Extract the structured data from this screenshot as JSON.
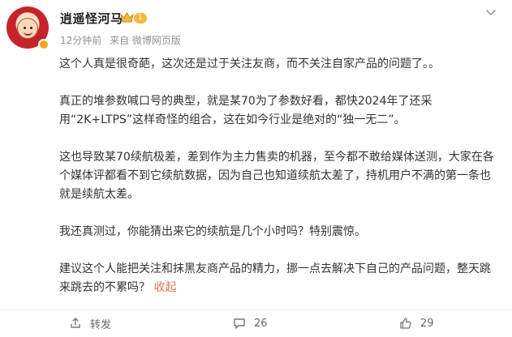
{
  "post": {
    "username": "逍遥怪河马",
    "level_badge": "1",
    "time": "12分钟前",
    "source": "来自 微博网页版",
    "paragraphs": [
      "这个人真是很奇葩，这次还是过于关注友商，而不关注自家产品的问题了。。",
      "真正的堆参数喊口号的典型，就是某70为了参数好看，都快2024年了还采用“2K+LTPS”这样奇怪的组合，这在如今行业是绝对的“独一无二”。",
      "这也导致某70续航极差，差到作为主力售卖的机器，至今都不敢给媒体送测，大家在各个媒体评都看不到它续航数据，因为自己也知道续航太差了，持机用户不满的第一条也就是续航太差。",
      "我还真测过，你能猜出来它的续航是几个小时吗？特别震惊。",
      "建议这个人能把关注和抹黑友商产品的精力，挪一点去解决下自己的产品问题，整天跳来跳去的不累吗？"
    ],
    "collapse_label": "收起"
  },
  "actions": {
    "share_label": "转发",
    "comment_count": "26",
    "like_count": "29"
  },
  "icons": {
    "crown": "crown-icon",
    "more": "chevron-down-icon",
    "share": "share-icon",
    "comment": "comment-icon",
    "like": "thumbs-up-icon"
  },
  "colors": {
    "link": "#eb7350",
    "meta": "#939393",
    "badge": "#f4b740"
  }
}
